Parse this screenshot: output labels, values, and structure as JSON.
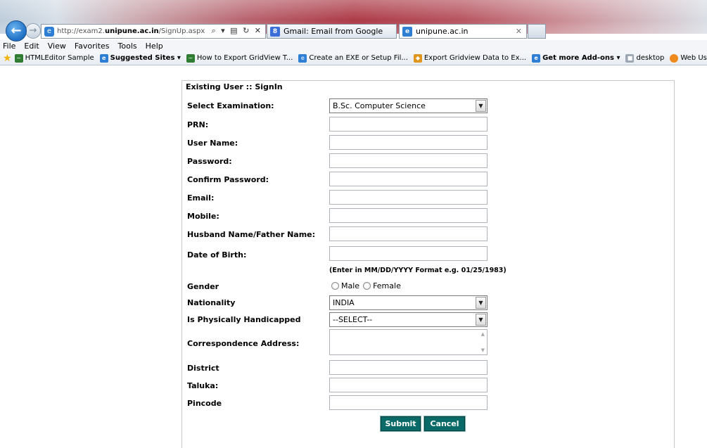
{
  "browser": {
    "address": {
      "prefix": "http://exam2.",
      "domain": "unipune.ac.in",
      "path": "/SignUp.aspx",
      "tools": "⌕ ▾ ▤ ↻ ✕"
    },
    "tabs": [
      {
        "label": "Gmail: Email from Google",
        "icon_color": "#3b6fd8",
        "icon_text": "8"
      },
      {
        "label": "unipune.ac.in",
        "icon_color": "#2e7fd3",
        "icon_text": "e"
      }
    ],
    "menu": [
      "File",
      "Edit",
      "View",
      "Favorites",
      "Tools",
      "Help"
    ],
    "favorites": [
      {
        "label": "HTMLEditor Sample",
        "bold": false,
        "icon_color": "#2e7d32"
      },
      {
        "label": "Suggested Sites ▾",
        "bold": true,
        "icon_color": "#2e7fd3"
      },
      {
        "label": "How to Export GridView T...",
        "bold": false,
        "icon_color": "#2e7d32"
      },
      {
        "label": "Create an EXE or Setup Fil...",
        "bold": false,
        "icon_color": "#2e7fd3"
      },
      {
        "label": "Export Gridview Data to Ex...",
        "bold": false,
        "icon_color": "#e0961c"
      },
      {
        "label": "Get more Add-ons ▾",
        "bold": true,
        "icon_color": "#2e7fd3"
      },
      {
        "label": "desktop",
        "bold": false,
        "icon_color": "#9aa6b2"
      },
      {
        "label": "Web User Con",
        "bold": false,
        "icon_color": "#f08a1c"
      }
    ]
  },
  "form": {
    "title": "Existing User :: SignIn",
    "labels": {
      "exam": "Select Examination:",
      "prn": "PRN:",
      "username": "User Name:",
      "password": "Password:",
      "confirm": "Confirm Password:",
      "email": "Email:",
      "mobile": "Mobile:",
      "husband": "Husband Name/Father Name:",
      "dob": "Date of Birth:",
      "gender": "Gender",
      "nationality": "Nationality",
      "handicapped": "Is Physically Handicapped",
      "address": "Correspondence Address:",
      "district": "District",
      "taluka": "Taluka:",
      "pincode": "Pincode"
    },
    "exam_value": "B.Sc. Computer Science",
    "dob_hint": "(Enter in MM/DD/YYYY Format e.g. 01/25/1983)",
    "gender_options": [
      "Male",
      "Female"
    ],
    "nationality_value": "INDIA",
    "handicapped_value": "--SELECT--",
    "submit_label": "Submit",
    "cancel_label": "Cancel"
  }
}
